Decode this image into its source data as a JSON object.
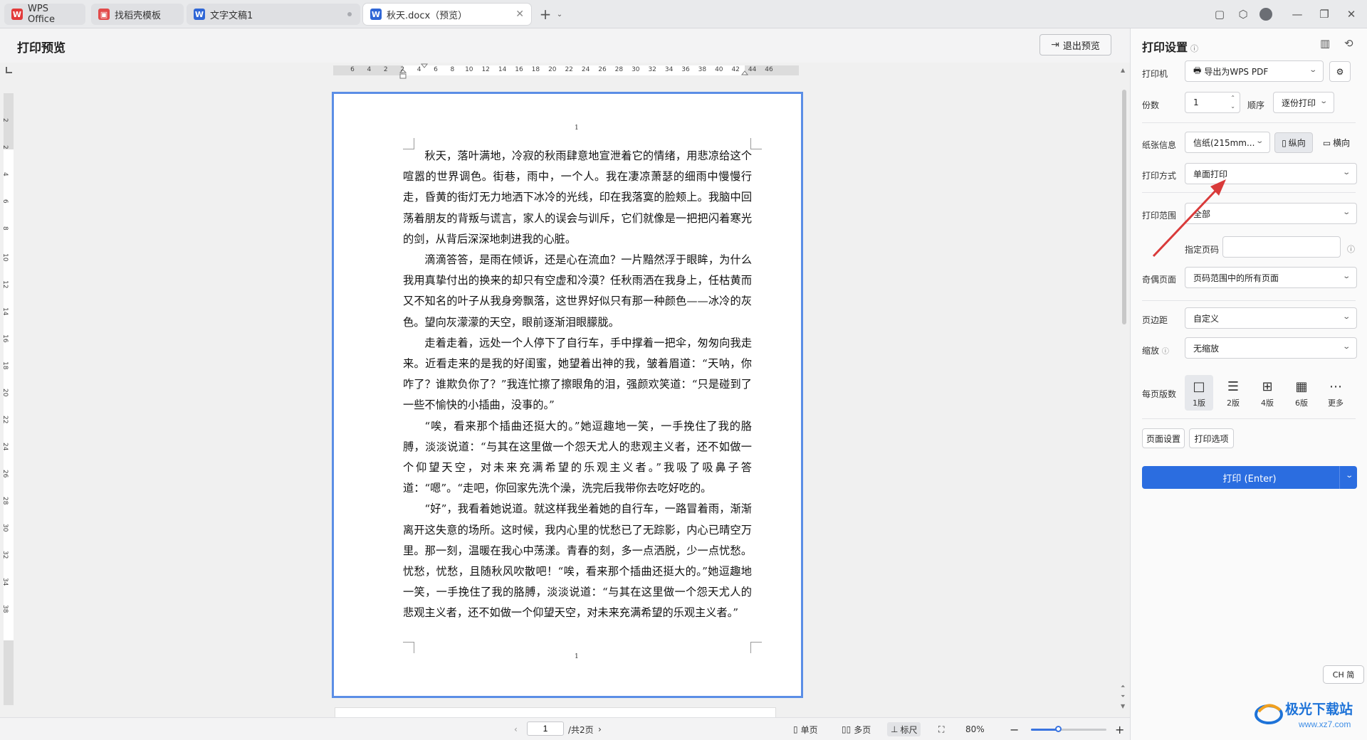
{
  "tabs": [
    {
      "label": "WPS Office",
      "icon": "wps-logo-icon"
    },
    {
      "label": "找稻壳模板",
      "icon": "docer-icon"
    },
    {
      "label": "文字文稿1",
      "icon": "word-doc-icon"
    },
    {
      "label": "秋天.docx（预览）",
      "icon": "word-doc-icon"
    }
  ],
  "header": {
    "title": "打印预览",
    "exit_label": "退出预览"
  },
  "ruler": {
    "h_numbers": [
      "6",
      "4",
      "2",
      "2",
      "4",
      "6",
      "8",
      "10",
      "12",
      "14",
      "16",
      "18",
      "20",
      "22",
      "24",
      "26",
      "28",
      "30",
      "32",
      "34",
      "36",
      "38",
      "40",
      "42",
      "44",
      "46"
    ],
    "v_numbers": [
      "2",
      "2",
      "4",
      "6",
      "8",
      "10",
      "12",
      "14",
      "16",
      "18",
      "20",
      "22",
      "24",
      "26",
      "28",
      "30",
      "32",
      "34",
      "38"
    ]
  },
  "document": {
    "header_page_num": "1",
    "footer_page_num": "1",
    "paragraphs": [
      "秋天，落叶满地，冷寂的秋雨肆意地宣泄着它的情绪，用悲凉给这个喧嚣的世界调色。街巷，雨中，一个人。我在凄凉萧瑟的细雨中慢慢行走，昏黄的街灯无力地洒下冰冷的光线，印在我落寞的脸颊上。我脑中回荡着朋友的背叛与谎言，家人的误会与训斥，它们就像是一把把闪着寒光的剑，从背后深深地刺进我的心脏。",
      "滴滴答答，是雨在倾诉，还是心在流血？一片黯然浮于眼眸，为什么我用真挚付出的换来的却只有空虚和冷漠？任秋雨洒在我身上，任枯黄而又不知名的叶子从我身旁飘落，这世界好似只有那一种颜色——冰冷的灰色。望向灰濛濛的天空，眼前逐渐泪眼朦胧。",
      "走着走着，远处一个人停下了自行车，手中撑着一把伞，匆匆向我走来。近看走来的是我的好闺蜜，她望着出神的我，皱着眉道：“天呐，你咋了？谁欺负你了？”我连忙擦了擦眼角的泪，强颜欢笑道：“只是碰到了一些不愉快的小插曲，没事的。”",
      "“唉，看来那个插曲还挺大的。”她逗趣地一笑，一手挽住了我的胳膊，淡淡说道：“与其在这里做一个怨天尤人的悲观主义者，还不如做一个仰望天空，对未来充满希望的乐观主义者。”我吸了吸鼻子答道：“嗯”。“走吧，你回家先洗个澡，洗完后我带你去吃好吃的。",
      "“好”，我看着她说道。就这样我坐着她的自行车，一路冒着雨，渐渐离开这失意的场所。这时候，我内心里的忧愁已了无踪影，内心已晴空万里。那一刻，温暖在我心中荡漾。青春的刻，多一点洒脱，少一点忧愁。忧愁，忧愁，且随秋风吹散吧！“唉，看来那个插曲还挺大的。”她逗趣地一笑，一手挽住了我的胳膊，淡淡说道：“与其在这里做一个怨天尤人的悲观主义者，还不如做一个仰望天空，对未来充满希望的乐观主义者。”"
    ]
  },
  "statusbar": {
    "page_value": "1",
    "total_pages": "/共2页",
    "single_page": "单页",
    "multi_page": "多页",
    "ruler": "标尺",
    "zoom": "80%",
    "zoom_level": 0.37
  },
  "panel": {
    "title": "打印设置",
    "printer_label": "打印机",
    "printer_value": "导出为WPS PDF",
    "copies_label": "份数",
    "copies_value": "1",
    "order_label": "顺序",
    "order_value": "逐份打印",
    "paper_label": "纸张信息",
    "paper_value": "信纸(215mm...",
    "portrait": "纵向",
    "landscape": "横向",
    "mode_label": "打印方式",
    "mode_value": "单面打印",
    "range_label": "打印范围",
    "range_value": "全部",
    "pages_label": "指定页码",
    "pages_value": "",
    "oddeven_label": "奇偶页面",
    "oddeven_value": "页码范围中的所有页面",
    "margin_label": "页边距",
    "margin_value": "自定义",
    "scale_label": "缩放",
    "scale_value": "无缩放",
    "per_page_label": "每页版数",
    "layouts": [
      "1版",
      "2版",
      "4版",
      "6版",
      "更多"
    ],
    "page_setup": "页面设置",
    "print_options": "打印选项",
    "print_button": "打印 (Enter)"
  },
  "ime": "CH 简",
  "watermark": {
    "text": "极光下载站",
    "url": "www.xz7.com"
  },
  "colors": {
    "accent": "#2b6de0",
    "arrow": "#d93a3a",
    "page_border": "#5b8ee6"
  }
}
